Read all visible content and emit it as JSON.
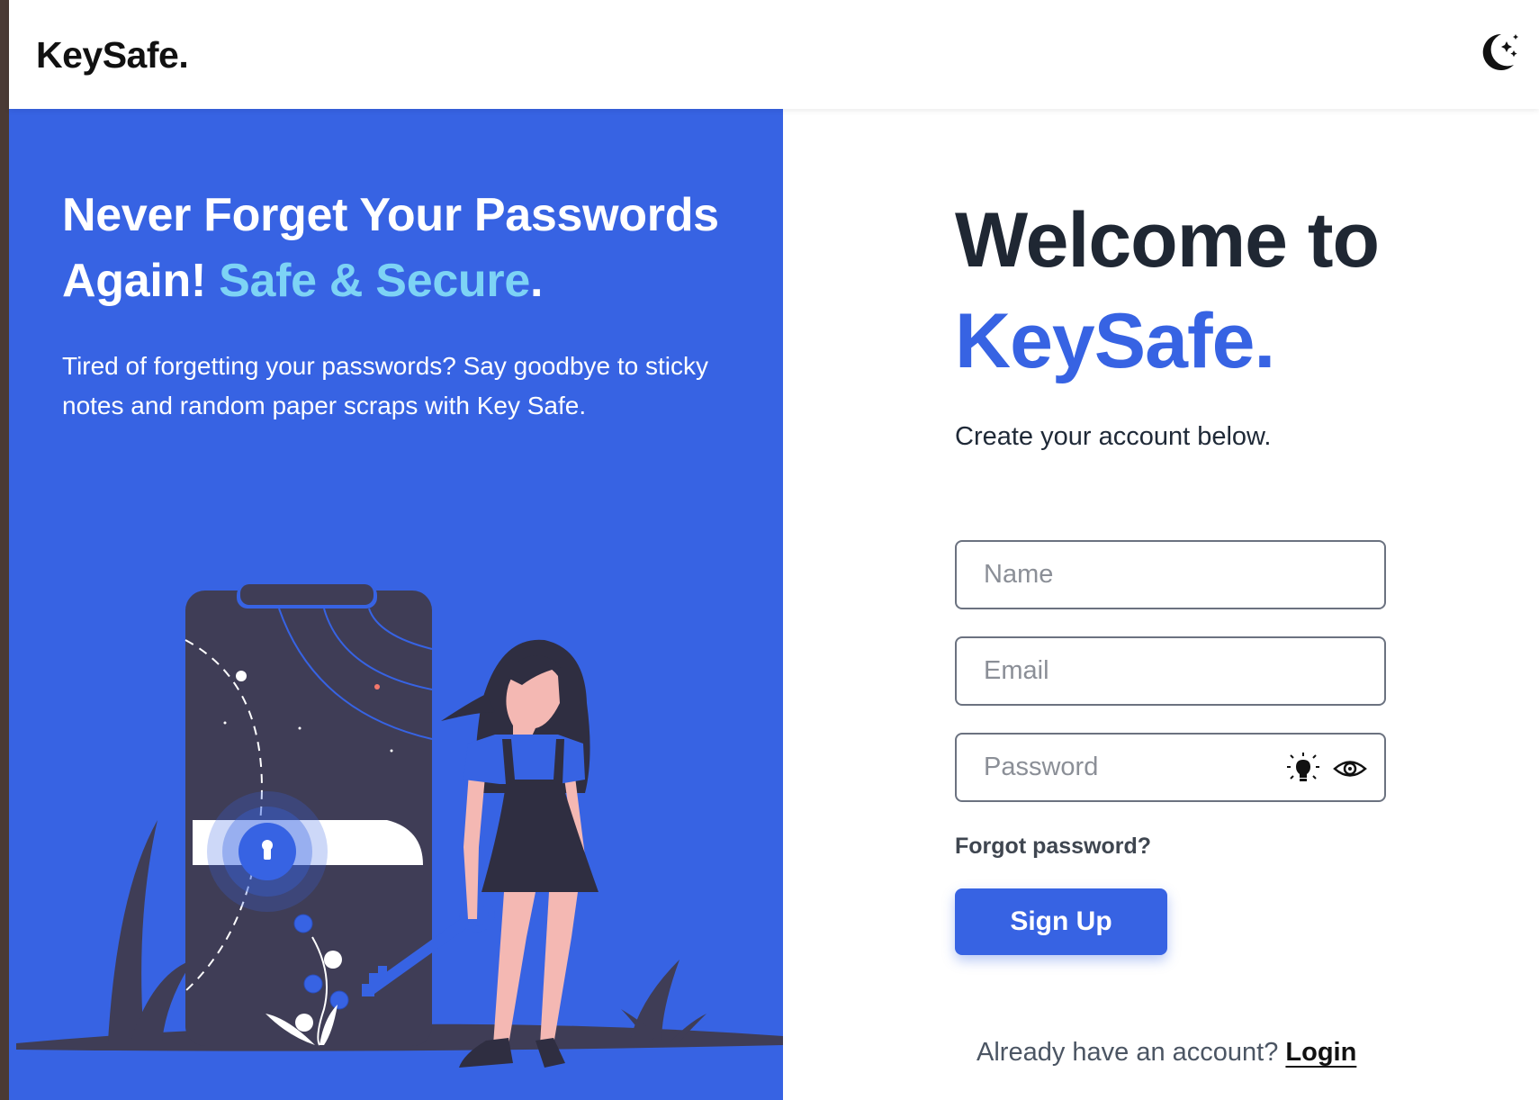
{
  "navbar": {
    "brand": "KeySafe.",
    "theme_toggle_icon": "moon-stars-icon"
  },
  "hero": {
    "title_part1": "Never Forget Your Passwords Again!",
    "title_accent": "Safe & Secure",
    "title_end": ".",
    "description": "Tired of forgetting your passwords? Say goodbye to sticky notes and random paper scraps with Key Safe.",
    "illustration": "phone-lock-woman-key-illustration"
  },
  "form": {
    "welcome_line1": "Welcome to",
    "welcome_brand": "KeySafe.",
    "subtitle": "Create your account below.",
    "name_placeholder": "Name",
    "email_placeholder": "Email",
    "password_placeholder": "Password",
    "password_icons": [
      "lightbulb-icon",
      "eye-icon"
    ],
    "forgot_password": "Forgot password?",
    "signup_label": "Sign Up",
    "already_text": "Already have an account?",
    "login_label": "Login"
  },
  "colors": {
    "primary": "#3763e3",
    "accent": "#7dd3f5",
    "dark_text": "#1f2733",
    "phone": "#3f3d56",
    "skin": "#f4b8b3"
  }
}
